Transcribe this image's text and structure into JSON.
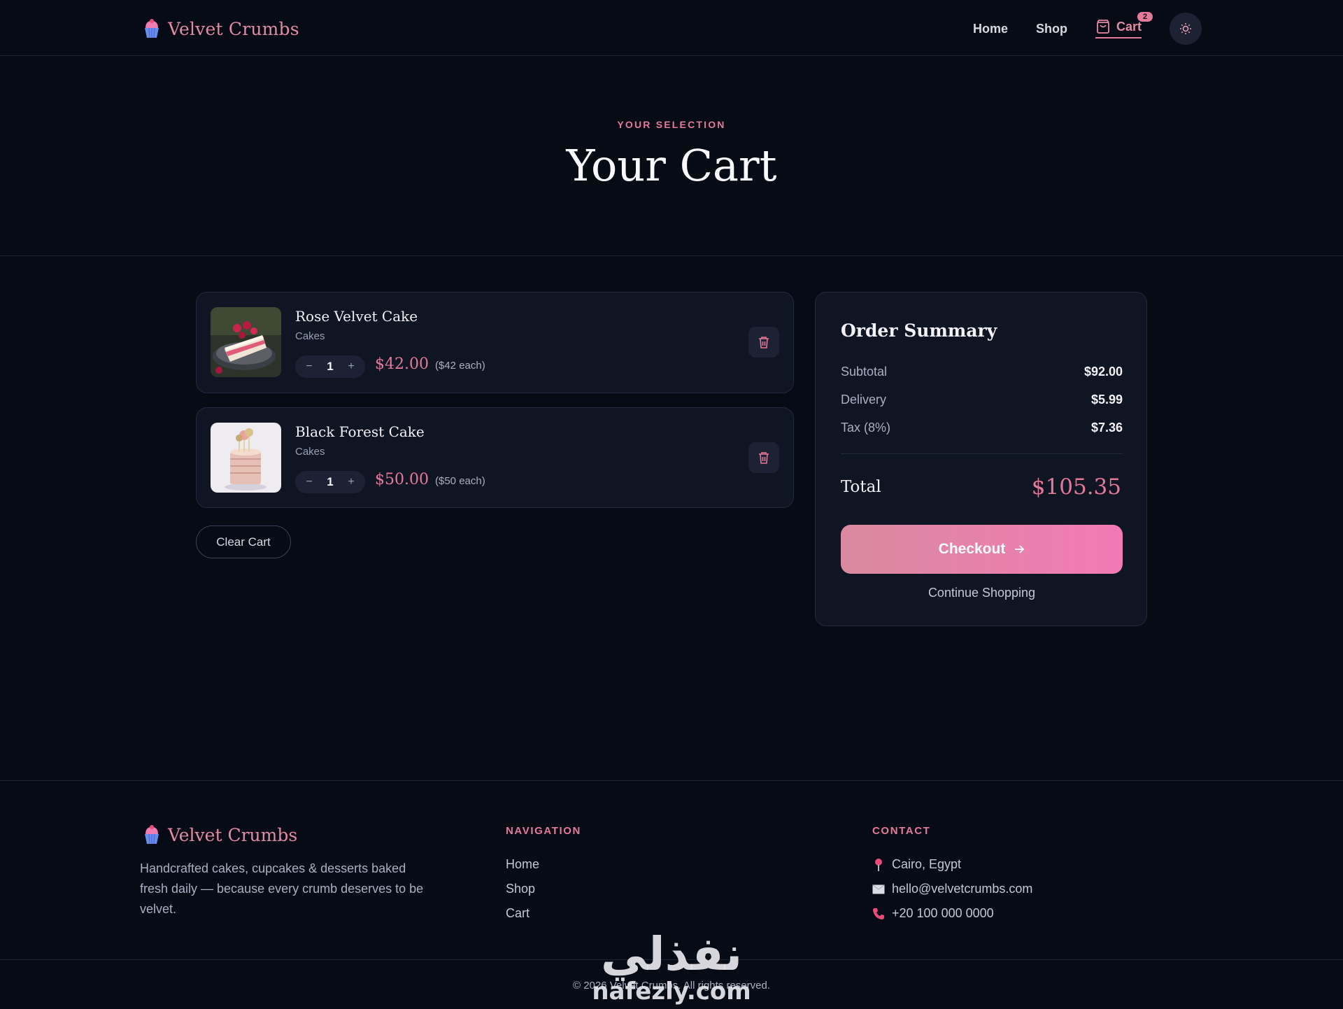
{
  "brand": {
    "name": "Velvet Crumbs",
    "accent": "#e5799a"
  },
  "nav": {
    "home": "Home",
    "shop": "Shop",
    "cart": "Cart",
    "cart_count": "2"
  },
  "hero": {
    "eyebrow": "YOUR SELECTION",
    "title": "Your Cart"
  },
  "items": [
    {
      "name": "Rose Velvet Cake",
      "category": "Cakes",
      "qty": "1",
      "price": "$42.00",
      "each": "($42 each)",
      "minus": "−",
      "plus": "+"
    },
    {
      "name": "Black Forest Cake",
      "category": "Cakes",
      "qty": "1",
      "price": "$50.00",
      "each": "($50 each)",
      "minus": "−",
      "plus": "+"
    }
  ],
  "clear_cart": "Clear Cart",
  "summary": {
    "title": "Order Summary",
    "subtotal_label": "Subtotal",
    "subtotal": "$92.00",
    "delivery_label": "Delivery",
    "delivery": "$5.99",
    "tax_label": "Tax (8%)",
    "tax": "$7.36",
    "total_label": "Total",
    "total": "$105.35",
    "checkout": "Checkout",
    "continue": "Continue Shopping"
  },
  "footer": {
    "brand": "Velvet Crumbs",
    "description": "Handcrafted cakes, cupcakes & desserts baked fresh daily — because every crumb deserves to be velvet.",
    "nav_title": "NAVIGATION",
    "nav_items": [
      "Home",
      "Shop",
      "Cart"
    ],
    "contact_title": "CONTACT",
    "location": "Cairo, Egypt",
    "email": "hello@velvetcrumbs.com",
    "phone": "+20 100 000 0000",
    "copyright": "© 2026 Velvet Crumbs. All rights reserved."
  },
  "watermark": {
    "arabic": "نفذلي",
    "latin": "nafezly.com"
  }
}
